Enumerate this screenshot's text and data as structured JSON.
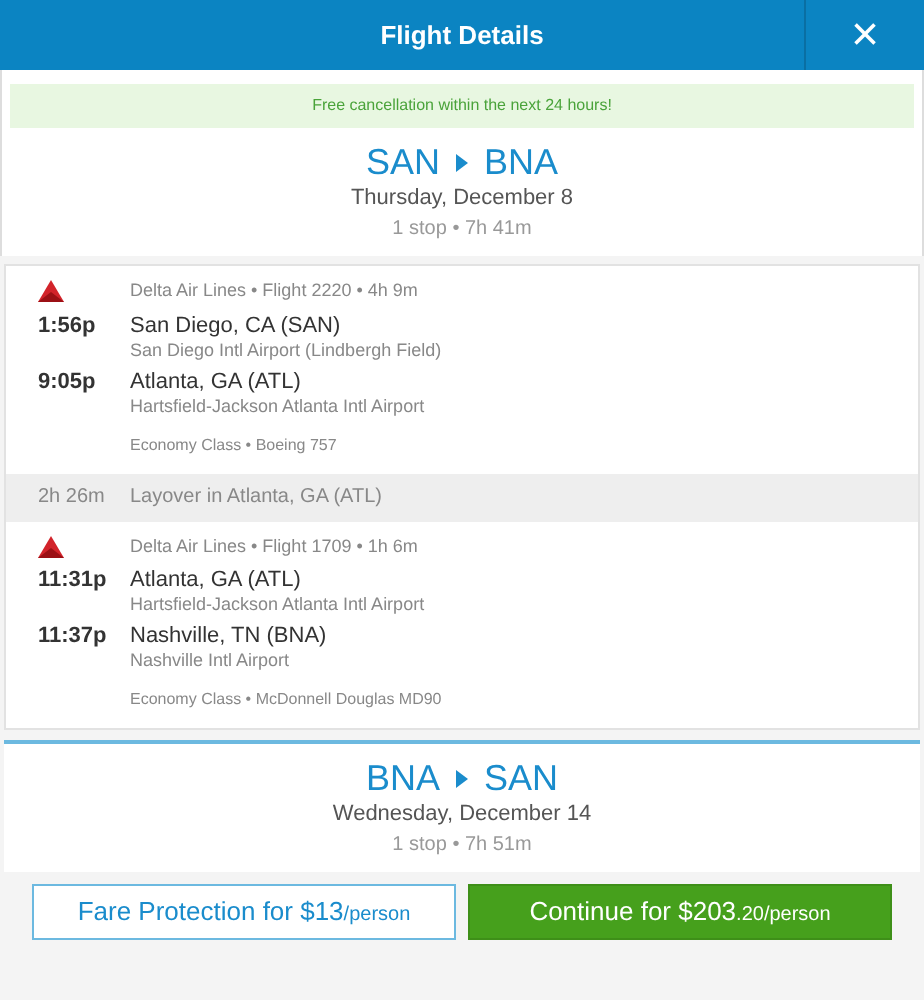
{
  "header": {
    "title": "Flight Details",
    "close": "×"
  },
  "notice": "Free cancellation within the next 24 hours!",
  "outbound": {
    "from": "SAN",
    "to": "BNA",
    "date": "Thursday, December 8",
    "summary": "1 stop • 7h 41m"
  },
  "items": [
    {
      "kind": "segment",
      "info": "Delta Air Lines • Flight 2220 • 4h 9m",
      "stops": [
        {
          "time": "1:56p",
          "city": "San Diego, CA (SAN)",
          "airport": "San Diego Intl Airport (Lindbergh Field)"
        },
        {
          "time": "9:05p",
          "city": "Atlanta, GA (ATL)",
          "airport": "Hartsfield-Jackson Atlanta Intl Airport"
        }
      ],
      "cabin": "Economy Class • Boeing 757"
    },
    {
      "kind": "layover",
      "duration": "2h 26m",
      "text": "Layover in Atlanta, GA (ATL)"
    },
    {
      "kind": "segment",
      "info": "Delta Air Lines • Flight 1709 • 1h 6m",
      "stops": [
        {
          "time": "11:31p",
          "city": "Atlanta, GA (ATL)",
          "airport": "Hartsfield-Jackson Atlanta Intl Airport"
        },
        {
          "time": "11:37p",
          "city": "Nashville, TN (BNA)",
          "airport": "Nashville Intl Airport"
        }
      ],
      "cabin": "Economy Class • McDonnell Douglas MD90"
    }
  ],
  "return": {
    "from": "BNA",
    "to": "SAN",
    "date": "Wednesday, December 14",
    "summary": "1 stop • 7h 51m"
  },
  "buttons": [
    {
      "kind": "outline",
      "label": "Fare Protection for $13",
      "suffix": "/person"
    },
    {
      "kind": "primary",
      "label": "Continue for $203",
      "suffix": ".20/person"
    }
  ]
}
